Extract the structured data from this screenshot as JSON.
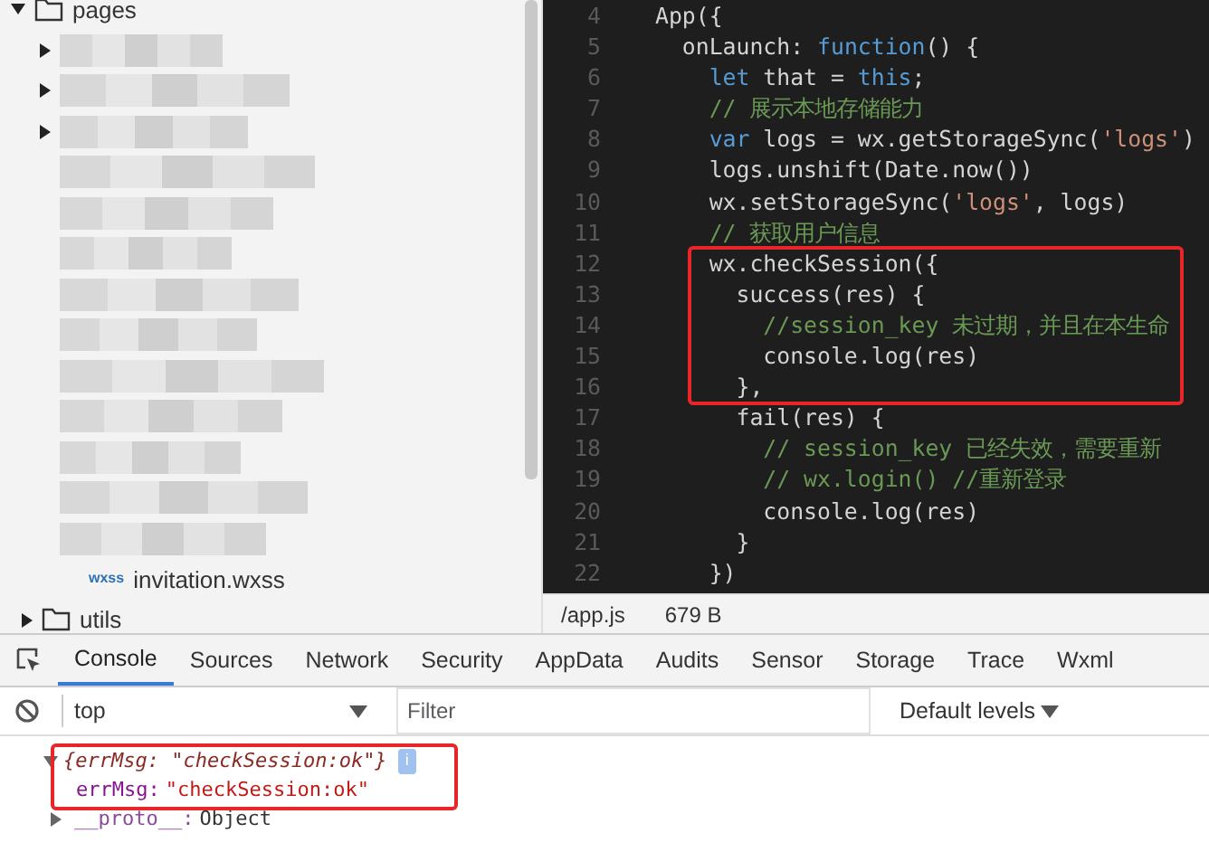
{
  "file_tree": {
    "root": {
      "label": "pages",
      "expanded": true,
      "children": [
        {
          "kind": "redacted",
          "expanded": false
        },
        {
          "kind": "redacted",
          "expanded": false
        },
        {
          "kind": "redacted",
          "expanded": false
        },
        {
          "kind": "redacted"
        },
        {
          "kind": "redacted"
        },
        {
          "kind": "redacted"
        },
        {
          "kind": "redacted"
        },
        {
          "kind": "redacted"
        },
        {
          "kind": "redacted"
        },
        {
          "kind": "redacted"
        },
        {
          "kind": "redacted"
        },
        {
          "kind": "redacted"
        },
        {
          "kind": "redacted"
        },
        {
          "kind": "file",
          "badge": "wxss",
          "label": "invitation.wxss"
        }
      ]
    },
    "after": [
      {
        "label": "utils",
        "expanded": false
      }
    ]
  },
  "editor": {
    "lines": [
      {
        "number": "4",
        "segments": [
          {
            "kind": "plain",
            "text": "App({"
          }
        ]
      },
      {
        "number": "5",
        "segments": [
          {
            "kind": "plain",
            "text": "  onLaunch: "
          },
          {
            "kind": "kw",
            "text": "function"
          },
          {
            "kind": "plain",
            "text": "() {"
          }
        ]
      },
      {
        "number": "6",
        "segments": [
          {
            "kind": "kw",
            "text": "    let"
          },
          {
            "kind": "plain",
            "text": " that = "
          },
          {
            "kind": "kw",
            "text": "this"
          },
          {
            "kind": "plain",
            "text": ";"
          }
        ]
      },
      {
        "number": "7",
        "segments": [
          {
            "kind": "cmt",
            "text": "    // 展示本地存储能力"
          }
        ]
      },
      {
        "number": "8",
        "segments": [
          {
            "kind": "kw",
            "text": "    var"
          },
          {
            "kind": "plain",
            "text": " logs = wx.getStorageSync("
          },
          {
            "kind": "str",
            "text": "'logs'"
          },
          {
            "kind": "plain",
            "text": ")"
          }
        ]
      },
      {
        "number": "9",
        "segments": [
          {
            "kind": "plain",
            "text": "    logs.unshift(Date.now())"
          }
        ]
      },
      {
        "number": "10",
        "segments": [
          {
            "kind": "plain",
            "text": "    wx.setStorageSync("
          },
          {
            "kind": "str",
            "text": "'logs'"
          },
          {
            "kind": "plain",
            "text": ", logs)"
          }
        ]
      },
      {
        "number": "11",
        "segments": [
          {
            "kind": "cmt",
            "text": "    // 获取用户信息"
          }
        ]
      },
      {
        "number": "12",
        "segments": [
          {
            "kind": "plain",
            "text": "    wx.checkSession({"
          }
        ]
      },
      {
        "number": "13",
        "segments": [
          {
            "kind": "plain",
            "text": "      success(res) {"
          }
        ]
      },
      {
        "number": "14",
        "segments": [
          {
            "kind": "cmt",
            "text": "        //session_key 未过期，并且在本生命"
          }
        ]
      },
      {
        "number": "15",
        "segments": [
          {
            "kind": "plain",
            "text": "        console.log(res)"
          }
        ]
      },
      {
        "number": "16",
        "segments": [
          {
            "kind": "plain",
            "text": "      },"
          }
        ]
      },
      {
        "number": "17",
        "segments": [
          {
            "kind": "plain",
            "text": "      fail(res) {"
          }
        ]
      },
      {
        "number": "18",
        "segments": [
          {
            "kind": "cmt",
            "text": "        // session_key 已经失效，需要重新"
          }
        ]
      },
      {
        "number": "19",
        "segments": [
          {
            "kind": "cmt",
            "text": "        // wx.login() //重新登录"
          }
        ]
      },
      {
        "number": "20",
        "segments": [
          {
            "kind": "plain",
            "text": "        console.log(res)"
          }
        ]
      },
      {
        "number": "21",
        "segments": [
          {
            "kind": "plain",
            "text": "      }"
          }
        ]
      },
      {
        "number": "22",
        "segments": [
          {
            "kind": "plain",
            "text": "    })"
          }
        ]
      }
    ],
    "status_bar": {
      "path": "/app.js",
      "size": "679 B"
    }
  },
  "devtools": {
    "tabs": [
      {
        "label": "Console",
        "selected": true
      },
      {
        "label": "Sources",
        "selected": false
      },
      {
        "label": "Network",
        "selected": false
      },
      {
        "label": "Security",
        "selected": false
      },
      {
        "label": "AppData",
        "selected": false
      },
      {
        "label": "Audits",
        "selected": false
      },
      {
        "label": "Sensor",
        "selected": false
      },
      {
        "label": "Storage",
        "selected": false
      },
      {
        "label": "Trace",
        "selected": false
      },
      {
        "label": "Wxml",
        "selected": false
      }
    ],
    "context": "top",
    "filter_placeholder": "Filter",
    "levels": "Default levels",
    "output": {
      "summary": "{errMsg: \"checkSession:ok\"}",
      "info_badge": "i",
      "expanded": true,
      "properties": [
        {
          "key": "errMsg:",
          "value": "\"checkSession:ok\"",
          "expandable": false
        },
        {
          "key": "__proto__:",
          "value": "Object",
          "expandable": true
        }
      ]
    }
  }
}
